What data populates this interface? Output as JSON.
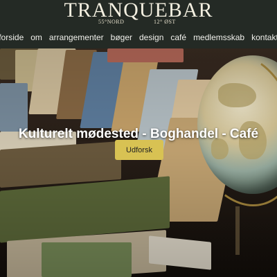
{
  "brand": {
    "name": "Tranquebar",
    "coord_left": "55°NORD",
    "coord_right": "12° ØST"
  },
  "nav": {
    "items": [
      "forside",
      "om",
      "arrangementer",
      "bøger",
      "design",
      "café",
      "medlemsskab",
      "kontakt"
    ]
  },
  "hero": {
    "headline": "Kulturelt mødested - Boghandel - Café",
    "cta_label": "Udforsk"
  }
}
